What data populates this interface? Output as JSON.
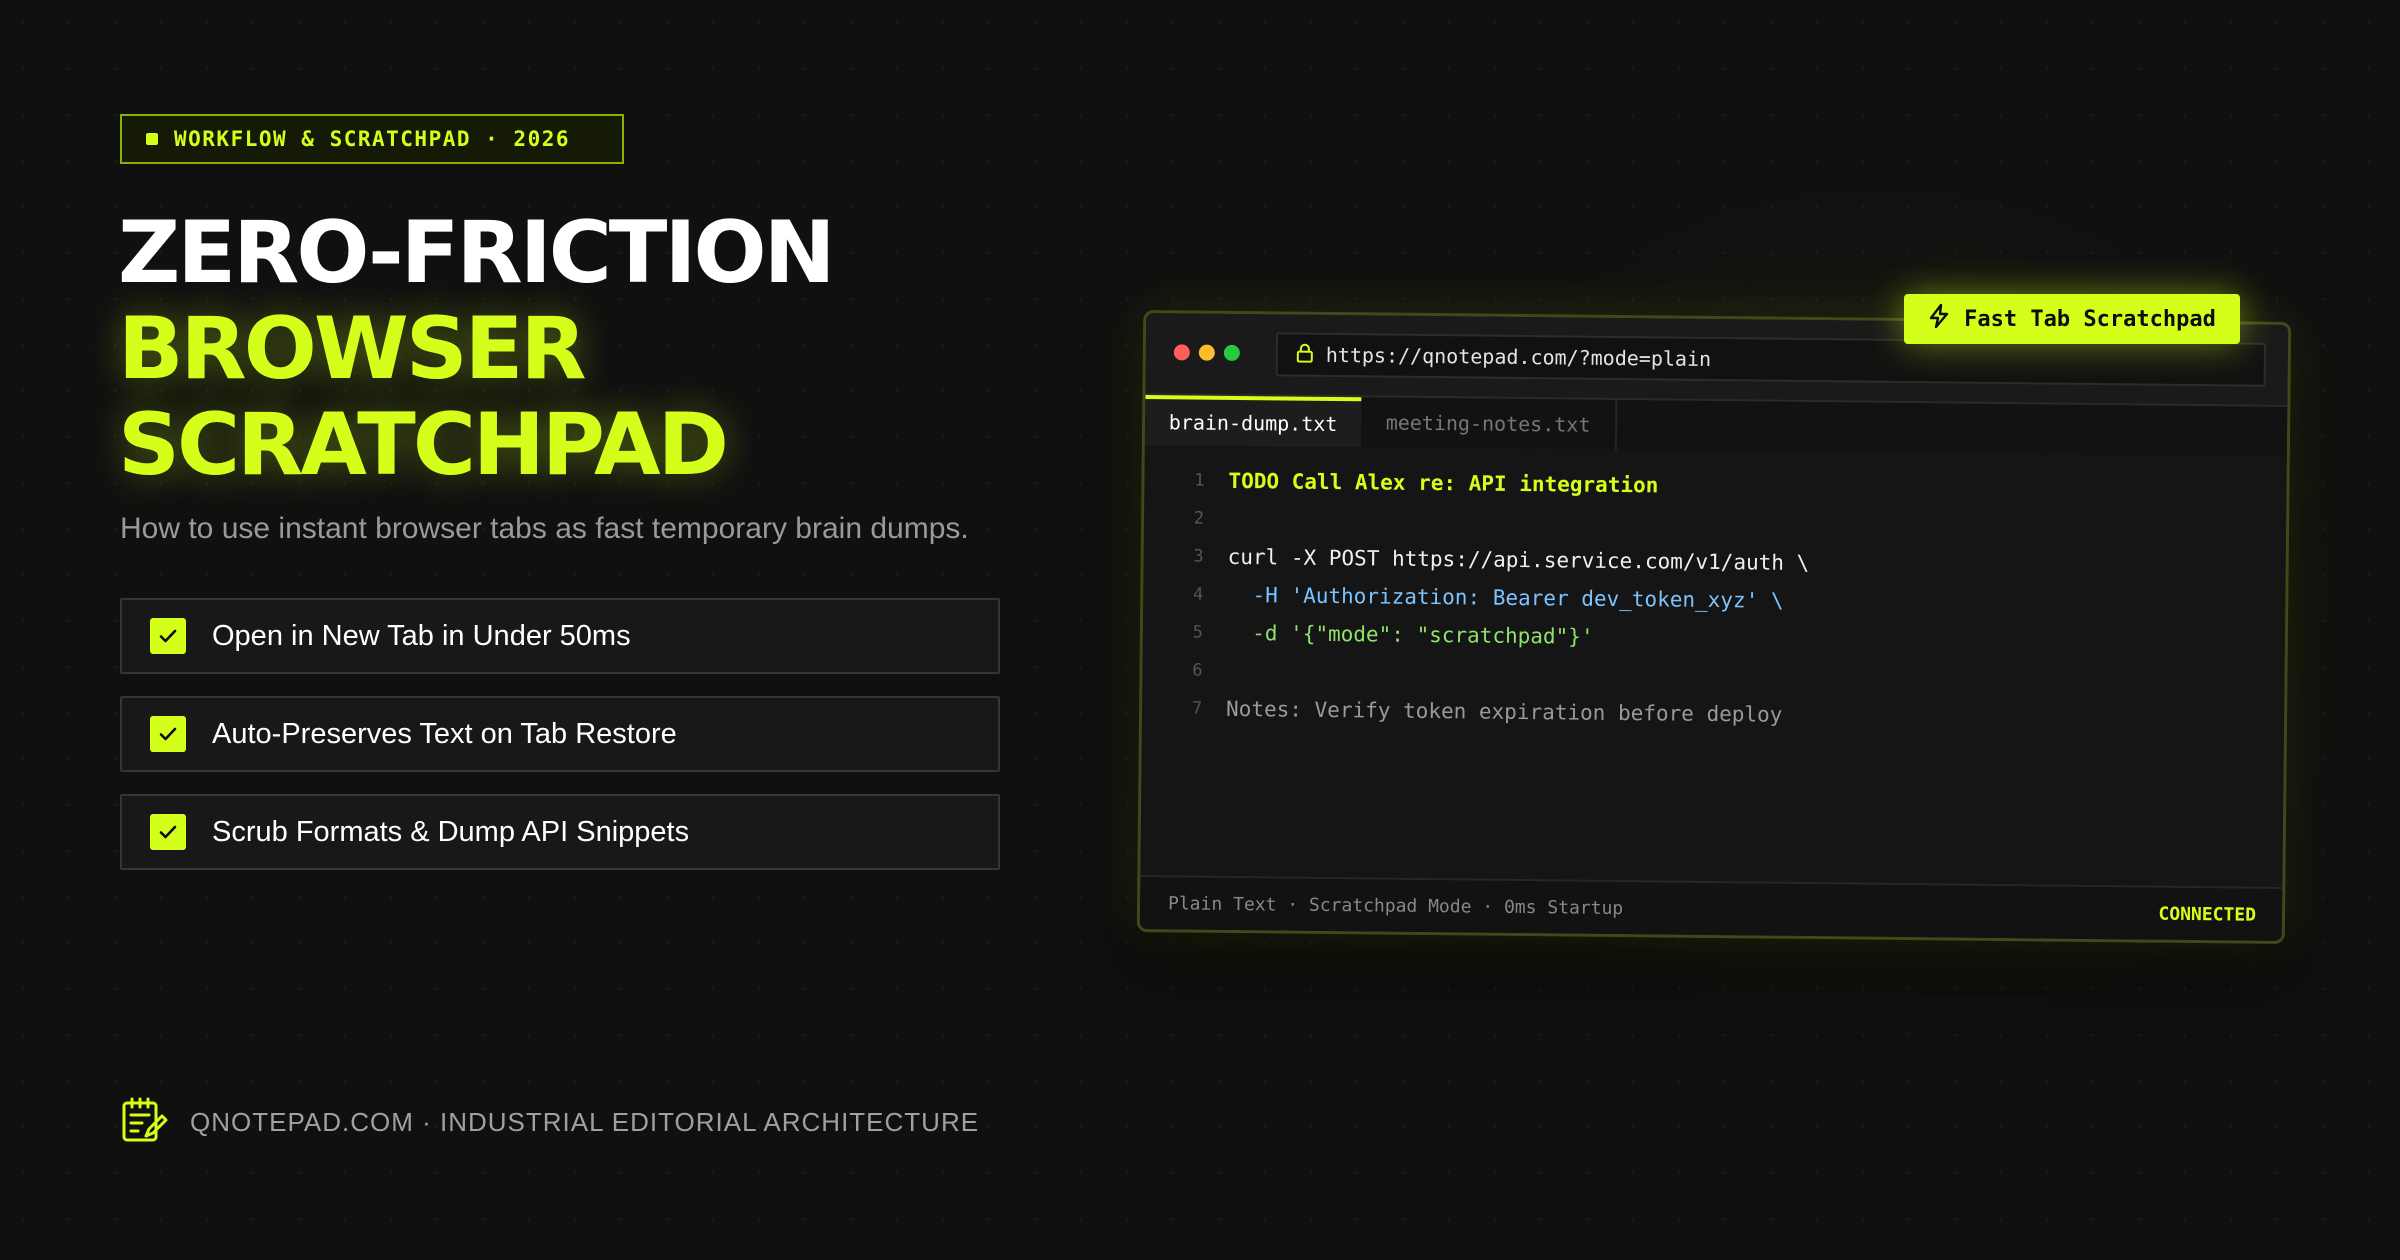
{
  "badge": {
    "label": "WORKFLOW & SCRATCHPAD · 2026"
  },
  "headline": {
    "line1": "ZERO-FRICTION",
    "line2": "BROWSER",
    "line3": "SCRATCHPAD"
  },
  "subtitle": "How to use instant browser tabs as fast temporary brain dumps.",
  "features": [
    {
      "label": "Open in New Tab in Under 50ms",
      "icon": "check-icon"
    },
    {
      "label": "Auto-Preserves Text on Tab Restore",
      "icon": "check-icon"
    },
    {
      "label": "Scrub Formats & Dump API Snippets",
      "icon": "check-icon"
    }
  ],
  "footer": {
    "text": "QNOTEPAD.COM · INDUSTRIAL EDITORIAL ARCHITECTURE",
    "icon": "notepad-pen-icon"
  },
  "window": {
    "url": "https://qnotepad.com/?mode=plain",
    "url_icon": "lock-icon",
    "tabs": [
      {
        "label": "brain-dump.txt",
        "active": true
      },
      {
        "label": "meeting-notes.txt",
        "active": false
      }
    ],
    "lines": [
      {
        "n": "1",
        "text": "TODO Call Alex re: API integration"
      },
      {
        "n": "2",
        "text": ""
      },
      {
        "n": "3",
        "text": "curl -X POST https://api.service.com/v1/auth \\"
      },
      {
        "n": "4",
        "text": "  -H 'Authorization: Bearer dev_token_xyz' \\"
      },
      {
        "n": "5",
        "text": "  -d '{\"mode\": \"scratchpad\"}'"
      },
      {
        "n": "6",
        "text": ""
      },
      {
        "n": "7",
        "text": "Notes: Verify token expiration before deploy"
      }
    ],
    "status_left": "Plain Text · Scratchpad Mode · 0ms Startup",
    "status_right": "CONNECTED"
  },
  "fast_badge": {
    "label": "Fast Tab Scratchpad",
    "icon": "lightning-icon"
  },
  "colors": {
    "accent": "#d4ff1a",
    "background": "#101010",
    "string": "#8ee36a",
    "flag": "#7cc4ff"
  }
}
